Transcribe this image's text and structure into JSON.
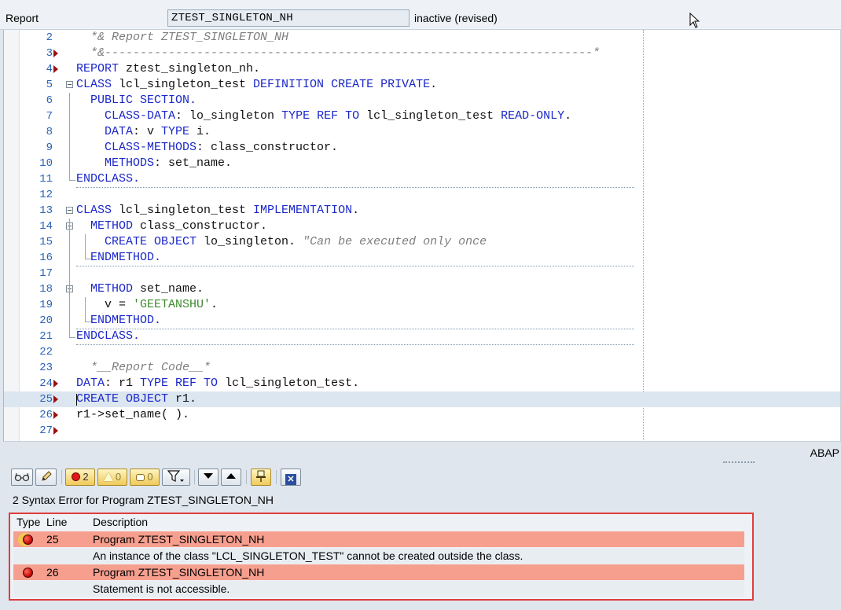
{
  "header": {
    "object_type_label": "Report",
    "program_name": "ZTEST_SINGLETON_NH",
    "status": "inactive (revised)"
  },
  "editor": {
    "language": "ABAP",
    "lines": [
      {
        "num": "2",
        "marker": false,
        "fold": false,
        "segments": [
          {
            "t": "  *& Report ZTEST_SINGLETON_NH",
            "c": "cm"
          }
        ]
      },
      {
        "num": "3",
        "marker": true,
        "fold": false,
        "segments": [
          {
            "t": "  *&---------------------------------------------------------------------*",
            "c": "cm"
          }
        ]
      },
      {
        "num": "4",
        "marker": true,
        "fold": false,
        "segments": [
          {
            "t": "REPORT",
            "c": "kw"
          },
          {
            "t": " ztest_singleton_nh.",
            "c": ""
          }
        ]
      },
      {
        "num": "5",
        "marker": false,
        "fold": true,
        "segments": [
          {
            "t": "CLASS",
            "c": "kw"
          },
          {
            "t": " lcl_singleton_test ",
            "c": ""
          },
          {
            "t": "DEFINITION CREATE PRIVATE",
            "c": "kw"
          },
          {
            "t": ".",
            "c": ""
          }
        ]
      },
      {
        "num": "6",
        "marker": false,
        "fold": false,
        "segments": [
          {
            "t": "  PUBLIC SECTION",
            "c": "kw"
          },
          {
            "t": ".",
            "c": "kw"
          }
        ]
      },
      {
        "num": "7",
        "marker": false,
        "fold": false,
        "segments": [
          {
            "t": "    CLASS-DATA",
            "c": "kw"
          },
          {
            "t": ": lo_singleton ",
            "c": ""
          },
          {
            "t": "TYPE REF TO",
            "c": "kw"
          },
          {
            "t": " lcl_singleton_test ",
            "c": ""
          },
          {
            "t": "READ-ONLY",
            "c": "kw"
          },
          {
            "t": ".",
            "c": ""
          }
        ]
      },
      {
        "num": "8",
        "marker": false,
        "fold": false,
        "segments": [
          {
            "t": "    DATA",
            "c": "kw"
          },
          {
            "t": ": v ",
            "c": ""
          },
          {
            "t": "TYPE",
            "c": "kw"
          },
          {
            "t": " i.",
            "c": ""
          }
        ]
      },
      {
        "num": "9",
        "marker": false,
        "fold": false,
        "segments": [
          {
            "t": "    CLASS-METHODS",
            "c": "kw"
          },
          {
            "t": ": class_constructor.",
            "c": ""
          }
        ]
      },
      {
        "num": "10",
        "marker": false,
        "fold": false,
        "segments": [
          {
            "t": "    METHODS",
            "c": "kw"
          },
          {
            "t": ": set_name.",
            "c": ""
          }
        ]
      },
      {
        "num": "11",
        "marker": false,
        "fold": false,
        "segments": [
          {
            "t": "ENDCLASS",
            "c": "kw"
          },
          {
            "t": ".",
            "c": "kw"
          }
        ]
      },
      {
        "num": "12",
        "marker": false,
        "fold": false,
        "segments": []
      },
      {
        "num": "13",
        "marker": false,
        "fold": true,
        "segments": [
          {
            "t": "CLASS",
            "c": "kw"
          },
          {
            "t": " lcl_singleton_test ",
            "c": ""
          },
          {
            "t": "IMPLEMENTATION",
            "c": "kw"
          },
          {
            "t": ".",
            "c": ""
          }
        ]
      },
      {
        "num": "14",
        "marker": false,
        "fold": true,
        "segments": [
          {
            "t": "  METHOD",
            "c": "kw"
          },
          {
            "t": " class_constructor.",
            "c": ""
          }
        ]
      },
      {
        "num": "15",
        "marker": false,
        "fold": false,
        "segments": [
          {
            "t": "    CREATE OBJECT",
            "c": "kw"
          },
          {
            "t": " lo_singleton. ",
            "c": ""
          },
          {
            "t": "\"Can be executed only once",
            "c": "cm"
          }
        ]
      },
      {
        "num": "16",
        "marker": false,
        "fold": false,
        "segments": [
          {
            "t": "  ENDMETHOD",
            "c": "kw"
          },
          {
            "t": ".",
            "c": "kw"
          }
        ]
      },
      {
        "num": "17",
        "marker": false,
        "fold": false,
        "segments": []
      },
      {
        "num": "18",
        "marker": false,
        "fold": true,
        "segments": [
          {
            "t": "  METHOD",
            "c": "kw"
          },
          {
            "t": " set_name.",
            "c": ""
          }
        ]
      },
      {
        "num": "19",
        "marker": false,
        "fold": false,
        "segments": [
          {
            "t": "    v = ",
            "c": ""
          },
          {
            "t": "'GEETANSHU'",
            "c": "st"
          },
          {
            "t": ".",
            "c": ""
          }
        ]
      },
      {
        "num": "20",
        "marker": false,
        "fold": false,
        "segments": [
          {
            "t": "  ENDMETHOD",
            "c": "kw"
          },
          {
            "t": ".",
            "c": "kw"
          }
        ]
      },
      {
        "num": "21",
        "marker": false,
        "fold": false,
        "segments": [
          {
            "t": "ENDCLASS",
            "c": "kw"
          },
          {
            "t": ".",
            "c": "kw"
          }
        ]
      },
      {
        "num": "22",
        "marker": false,
        "fold": false,
        "segments": []
      },
      {
        "num": "23",
        "marker": false,
        "fold": false,
        "segments": [
          {
            "t": "  *__Report Code__*",
            "c": "cm"
          }
        ]
      },
      {
        "num": "24",
        "marker": true,
        "fold": false,
        "segments": [
          {
            "t": "DATA",
            "c": "kw"
          },
          {
            "t": ": r1 ",
            "c": ""
          },
          {
            "t": "TYPE REF TO",
            "c": "kw"
          },
          {
            "t": " lcl_singleton_test.",
            "c": ""
          }
        ]
      },
      {
        "num": "25",
        "marker": true,
        "fold": false,
        "highlight": true,
        "segments": [
          {
            "t": "CREATE OBJECT",
            "c": "kw"
          },
          {
            "t": " r1.",
            "c": ""
          }
        ]
      },
      {
        "num": "26",
        "marker": true,
        "fold": false,
        "segments": [
          {
            "t": "r1->set_name( ).",
            "c": ""
          }
        ]
      },
      {
        "num": "27",
        "marker": true,
        "fold": false,
        "segments": []
      }
    ]
  },
  "toolbar": {
    "error_count": "2",
    "warning_count": "0",
    "info_count": "0",
    "icons": [
      "glasses-icon",
      "pencil-icon",
      "error-filter-icon",
      "warning-filter-icon",
      "info-filter-icon",
      "filter-funnel-icon",
      "arrow-down-icon",
      "arrow-up-icon",
      "pin-icon",
      "close-icon"
    ]
  },
  "errors": {
    "title": "2 Syntax Error for Program ZTEST_SINGLETON_NH",
    "columns": [
      "Type",
      "Line",
      "Description"
    ],
    "rows": [
      {
        "line": "25",
        "program": "Program ZTEST_SINGLETON_NH",
        "message": "An instance of the class \"LCL_SINGLETON_TEST\" cannot be created outside the class."
      },
      {
        "line": "26",
        "program": "Program ZTEST_SINGLETON_NH",
        "message": "Statement is not accessible."
      }
    ]
  },
  "colors": {
    "keyword": "#1b27c9",
    "comment": "#7e7e7e",
    "string": "#3d8b2f",
    "line_number": "#2a63b7",
    "error_row": "#f79f8f",
    "highlight_frame": "#e03c3c"
  }
}
